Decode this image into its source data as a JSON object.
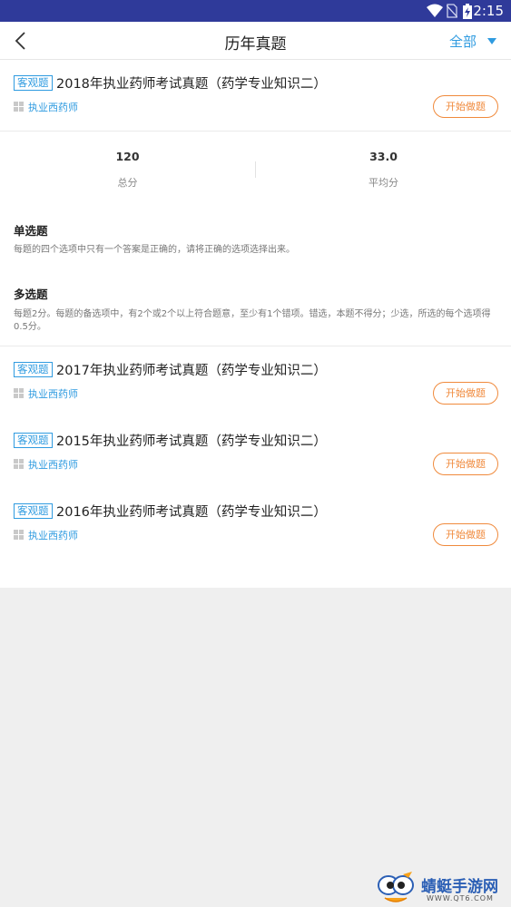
{
  "status_bar": {
    "time": "2:15",
    "icons": [
      "wifi-icon",
      "no-sim-icon",
      "battery-charging-icon"
    ],
    "color": "#2f3a9a"
  },
  "nav": {
    "back_icon": "chevron-left-icon",
    "title": "历年真题",
    "filter_label": "全部",
    "filter_icon": "triangle-down-icon"
  },
  "exams": [
    {
      "tag": "客观题",
      "title": "2018年执业药师考试真题（药学专业知识二）",
      "category": "执业西药师",
      "button": "开始做题"
    },
    {
      "tag": "客观题",
      "title": "2017年执业药师考试真题（药学专业知识二）",
      "category": "执业西药师",
      "button": "开始做题"
    },
    {
      "tag": "客观题",
      "title": "2015年执业药师考试真题（药学专业知识二）",
      "category": "执业西药师",
      "button": "开始做题"
    },
    {
      "tag": "客观题",
      "title": "2016年执业药师考试真题（药学专业知识二）",
      "category": "执业西药师",
      "button": "开始做题"
    }
  ],
  "stats": {
    "total_score": {
      "value": "120",
      "label": "总分"
    },
    "average_score": {
      "value": "33.0",
      "label": "平均分"
    }
  },
  "question_types": [
    {
      "title": "单选题",
      "description": "每题的四个选项中只有一个答案是正确的，请将正确的选项选择出来。"
    },
    {
      "title": "多选题",
      "description": "每题2分。每题的备选项中，有2个或2个以上符合题意，至少有1个错项。错选，本题不得分；少选，所选的每个选项得0.5分。"
    }
  ],
  "watermark": {
    "name": "蜻蜓手游网",
    "url": "WWW.QT6.COM"
  },
  "colors": {
    "accent_blue": "#2f9be0",
    "accent_orange": "#f08a3c",
    "statusbar": "#2f3a9a"
  }
}
